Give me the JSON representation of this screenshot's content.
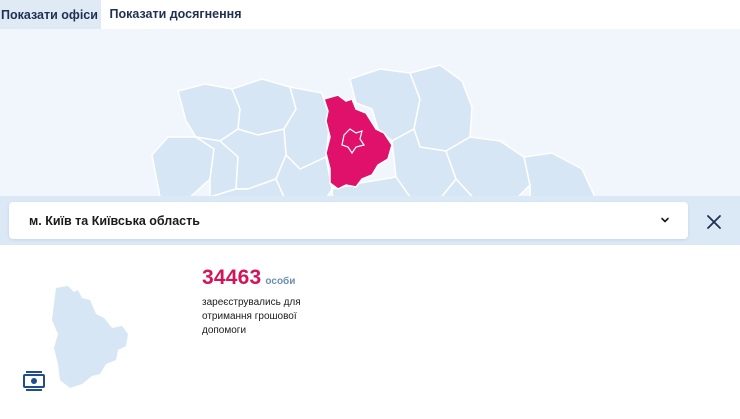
{
  "tabs": [
    {
      "label": "Показати офіси",
      "active": false
    },
    {
      "label": "Показати досягнення",
      "active": true
    }
  ],
  "region": {
    "selected": "м. Київ та Київська область"
  },
  "stats": {
    "value": "34463",
    "unit": "особи",
    "description": "зареєструвались для отримання грошової допомоги"
  },
  "colors": {
    "highlight": "#e0116a",
    "map_region": "#d6e6f5",
    "accent_text": "#d4145a",
    "header_bg": "#dbe9f7"
  },
  "icons": {
    "chevron": "chevron-down-icon",
    "close": "close-icon",
    "money": "money-icon"
  }
}
